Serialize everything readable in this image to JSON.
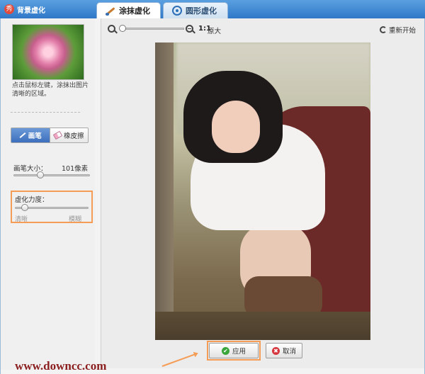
{
  "app": {
    "title": "背景虚化",
    "icon": "app-logo-icon"
  },
  "tabs": [
    {
      "label": "涂抹虚化",
      "icon": "brush-icon",
      "active": true
    },
    {
      "label": "圆形虚化",
      "icon": "circle-target-icon",
      "active": false
    }
  ],
  "sidebar": {
    "hint": "点击鼠标左键，涂抹出图片清晰的区域。",
    "tools": [
      {
        "label": "画笔",
        "icon": "brush-icon",
        "active": true
      },
      {
        "label": "橡皮擦",
        "icon": "eraser-icon",
        "active": false
      }
    ],
    "brush_size": {
      "label": "画笔大小：",
      "value_text": "101像素",
      "value": 101
    },
    "blur_strength": {
      "label": "虚化力度：",
      "min_label": "清晰",
      "max_label": "模糊",
      "value": 0.08
    }
  },
  "toolbar": {
    "zoom_ratio": "1:1",
    "original_label": "原大",
    "restart_label": "重新开始",
    "zoom_value": 0.02
  },
  "actions": {
    "apply_label": "应用",
    "cancel_label": "取消"
  },
  "watermark": "www.downcc.com",
  "colors": {
    "accent": "#f59d56",
    "brand": "#2f78c8"
  }
}
